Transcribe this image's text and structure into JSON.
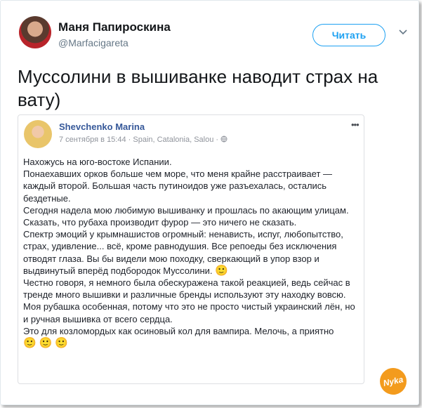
{
  "tweet": {
    "author_name": "Маня Папироскина",
    "author_handle": "@Marfacigareta",
    "follow_label": "Читать",
    "text": "Муссолини в вышиванке наводит страх на вату)"
  },
  "fb_post": {
    "author": "Shevchenko Marina",
    "meta": "7 сентября в 15:44 · Spain, Catalonia, Salou ·",
    "more": "•••",
    "lines": [
      "Нахожусь на юго-востоке Испании.",
      "Понаехавших орков больше чем море, что меня крайне расстраивает — каждый второй. Большая часть путиноидов уже разъехалась, остались бездетные.",
      "Сегодня надела мою любимую вышиванку и прошлась по акающим улицам. Сказать, что рубаха производит фурор — это ничего не сказать.",
      "Спектр эмоций у крымнашистов огромный: ненависть, испуг, любопытство, страх, удивление... всё, кроме равнодушия. Все репоеды без исключения отводят глаза. Вы бы видели мою походку, сверкающий в упор взор и выдвинутый вперёд подбородок Муссолини.",
      "Честно говоря, я немного была обескуражена такой реакцией, ведь сейчас в тренде много вышивки и различные бренды используют эту находку вовсю.",
      "Моя рубашка особенная, потому что это не просто чистый украинский лён, но и ручная вышивка от всего сердца.",
      "Это для козломордых как осиновый кол для вампира. Мелочь, а приятно"
    ],
    "emoji": [
      "🙂",
      "🙂",
      "🙂"
    ]
  },
  "watermark": "Nyka",
  "colors": {
    "accent": "#1da1f2",
    "fb_link": "#365899",
    "watermark": "#f39b1d"
  }
}
